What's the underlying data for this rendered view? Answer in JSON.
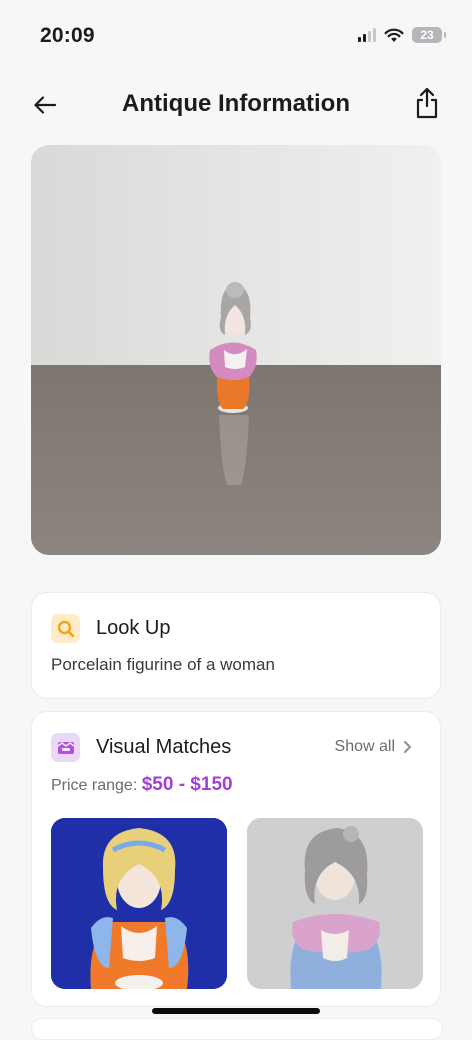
{
  "status_bar": {
    "time": "20:09",
    "battery": "23"
  },
  "nav": {
    "title": "Antique Information"
  },
  "lookup": {
    "title": "Look Up",
    "description": "Porcelain figurine of a woman"
  },
  "matches": {
    "title": "Visual Matches",
    "show_all": "Show all",
    "price_label": "Price range:",
    "price_value": "$50 - $150"
  },
  "colors": {
    "accent": "#a23fd6",
    "lookup_icon_bg": "#fdecc8",
    "matches_icon_bg": "#ead8f7"
  }
}
